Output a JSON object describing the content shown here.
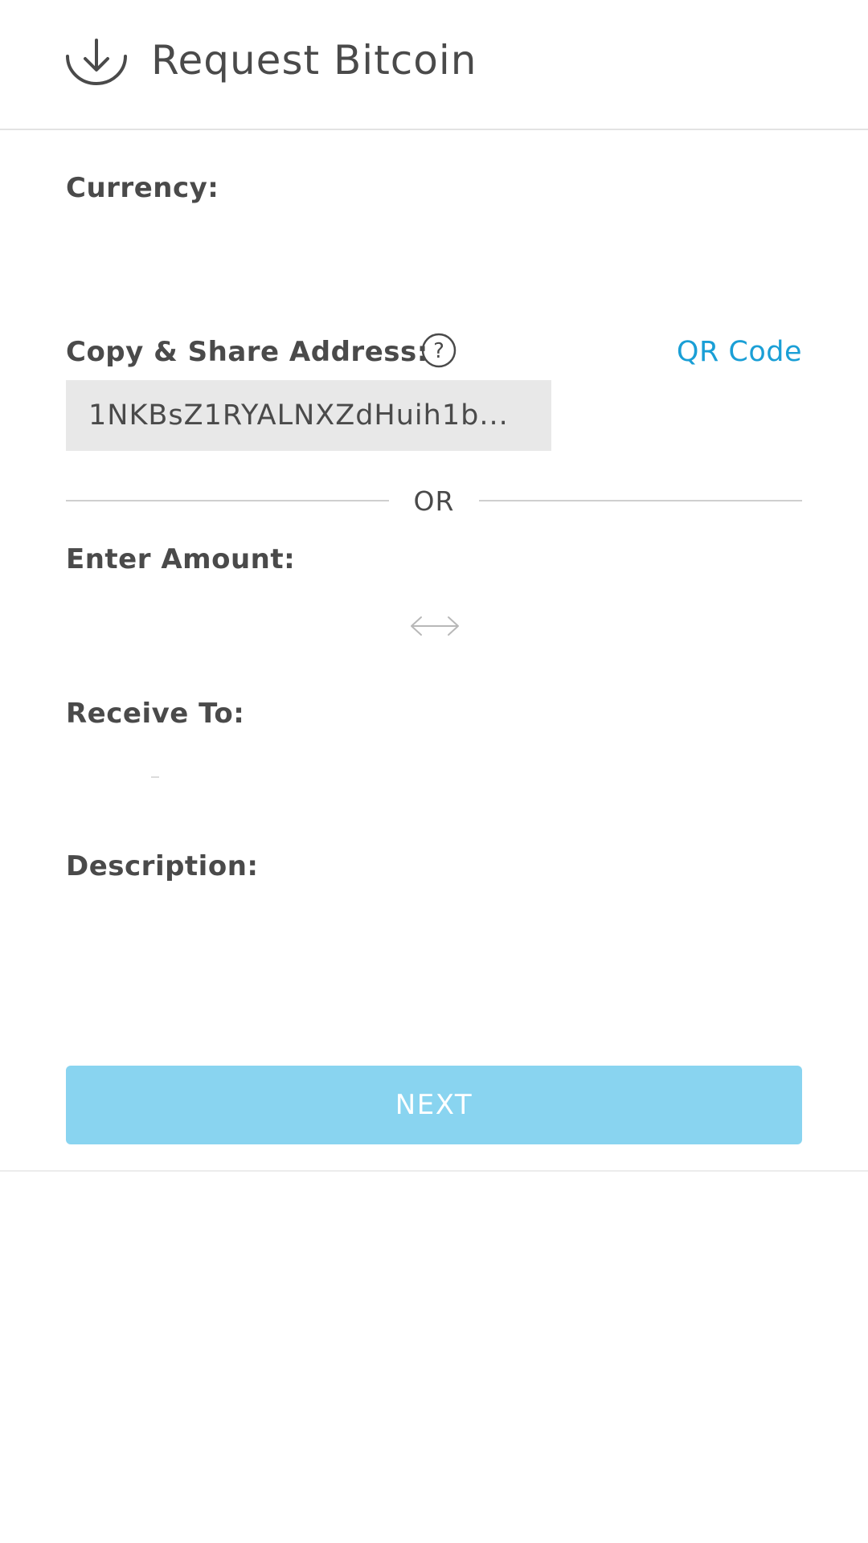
{
  "header": {
    "title": "Request Bitcoin",
    "icon": "download-icon"
  },
  "currency": {
    "label": "Currency:",
    "value": ""
  },
  "address": {
    "label": "Copy & Share Address:",
    "help_icon": "question-circle-icon",
    "qr_link": "QR Code",
    "value": "1NKBsZ1RYALNXZdHuih1b..."
  },
  "divider": {
    "text": "OR"
  },
  "amount": {
    "label": "Enter Amount:",
    "swap_icon": "swap-arrows-icon"
  },
  "receive": {
    "label": "Receive To:"
  },
  "description": {
    "label": "Description:"
  },
  "next_button": {
    "label": "NEXT"
  },
  "colors": {
    "accent": "#1a9fd6",
    "button_disabled": "#89d4f0",
    "text": "#4a4a4a",
    "address_bg": "#e8e8e8"
  }
}
